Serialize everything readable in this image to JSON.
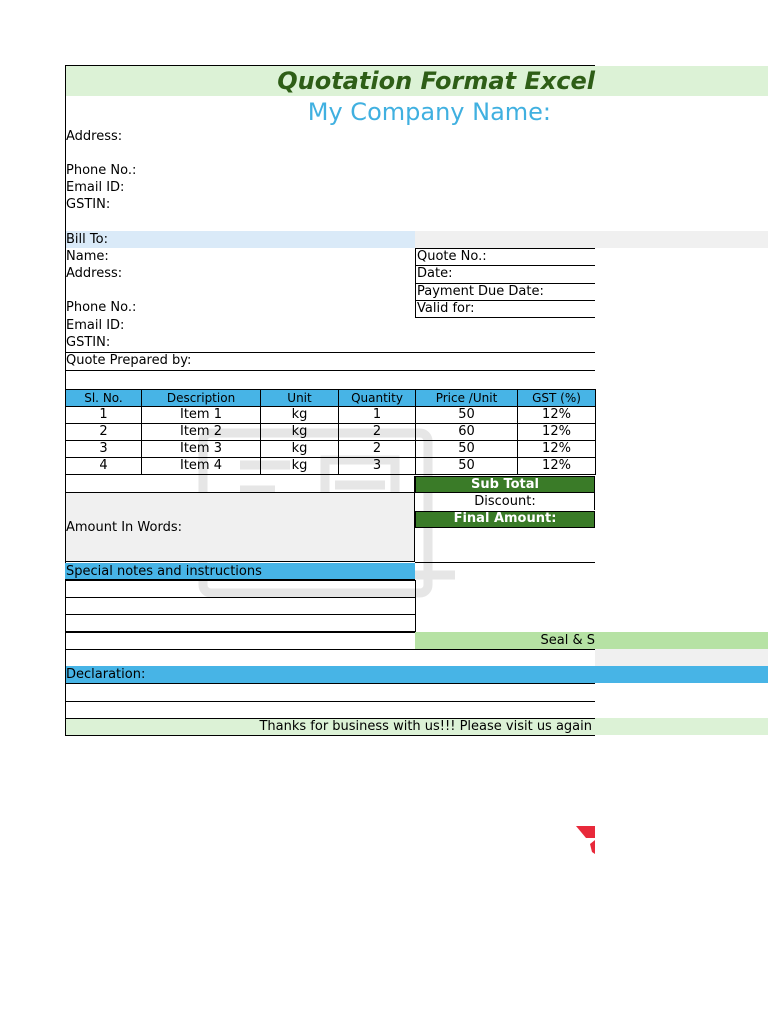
{
  "colors": {
    "title_green": "#2e5e17",
    "light_green": "#dcf2d6",
    "company_blue": "#40b0e0",
    "light_blue": "#daeaf8",
    "header_blue": "#47b4e6",
    "dark_green": "#3a7b28",
    "seal_green": "#b6e2a4",
    "light_gray": "#f0f0f0"
  },
  "header": {
    "title": "Quotation Format Excel",
    "company_name": "My Company Name:"
  },
  "company": {
    "address_label": "Address:",
    "phone_label": "Phone No.:",
    "email_label": "Email ID:",
    "gstin_label": "GSTIN:"
  },
  "bill_to": {
    "heading": "Bill To:",
    "name_label": "Name:",
    "address_label": "Address:",
    "phone_label": "Phone No.:",
    "email_label": "Email ID:",
    "gstin_label": "GSTIN:"
  },
  "quote_meta": {
    "quote_no_label": "Quote No.:",
    "date_label": "Date:",
    "payment_due_label": "Payment Due Date:",
    "valid_for_label": "Valid for:"
  },
  "prepared_by_label": "Quote Prepared by:",
  "items_table": {
    "headers": [
      "Sl. No.",
      "Description",
      "Unit",
      "Quantity",
      "Price /Unit",
      "GST (%)"
    ],
    "rows": [
      [
        "1",
        "Item 1",
        "kg",
        "1",
        "50",
        "12%"
      ],
      [
        "2",
        "Item 2",
        "kg",
        "2",
        "60",
        "12%"
      ],
      [
        "3",
        "Item 3",
        "kg",
        "2",
        "50",
        "12%"
      ],
      [
        "4",
        "Item 4",
        "kg",
        "3",
        "50",
        "12%"
      ]
    ]
  },
  "totals": {
    "sub_total_label": "Sub Total",
    "discount_label": "Discount:",
    "final_amount_label": "Final Amount:"
  },
  "amount_in_words_label": "Amount In Words:",
  "special_notes_label": "Special notes and instructions",
  "seal_label": "Seal & S",
  "declaration_label": "Declaration:",
  "footer_text": "Thanks for business with us!!! Please visit us again"
}
